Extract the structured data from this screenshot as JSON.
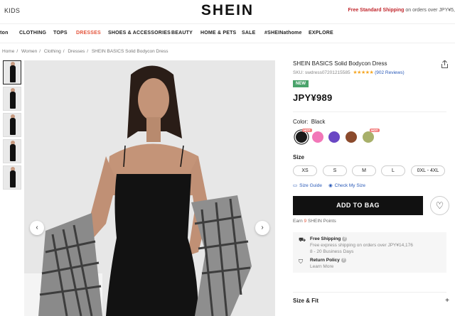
{
  "topbar": {
    "kids": "KIDS",
    "logo": "SHEIN",
    "promo_red": "Free Standard Shipping",
    "promo_rest": " on orders over JPY¥5,"
  },
  "nav": {
    "items": [
      {
        "label": "lton"
      },
      {
        "label": "CLOTHING"
      },
      {
        "label": "TOPS"
      },
      {
        "label": "DRESSES",
        "active": true
      },
      {
        "label": "SHOES & ACCESSORIES"
      },
      {
        "label": "BEAUTY"
      },
      {
        "label": "HOME & PETS"
      },
      {
        "label": "SALE"
      },
      {
        "label": "#SHEINathome"
      },
      {
        "label": "EXPLORE"
      }
    ]
  },
  "breadcrumb": [
    "Home",
    "Women",
    "Clothing",
    "Dresses",
    "SHEIN BASICS Solid Bodycon Dress"
  ],
  "gallery": {
    "thumbnail_count": 5,
    "prev_icon": "chevron-left-icon",
    "next_icon": "chevron-right-icon"
  },
  "product": {
    "title": "SHEIN BASICS Solid Bodycon Dress",
    "sku": "SKU: swdress07201215585",
    "stars": "★★★★★",
    "rating": 4.5,
    "reviews": "(902 Reviews)",
    "badge": "NEW",
    "price": "JPY¥989",
    "color_label": "Color:",
    "color_value": "Black",
    "swatches": [
      {
        "color": "#1a1a1a",
        "selected": true,
        "hot": true
      },
      {
        "color": "#f277b8"
      },
      {
        "color": "#6a47c4"
      },
      {
        "color": "#8b4a2c"
      },
      {
        "color": "#a8b06a",
        "hot": true
      }
    ],
    "hot_label": "HOT",
    "size_label": "Size",
    "sizes": [
      "XS",
      "S",
      "M",
      "L",
      "0XL - 4XL"
    ],
    "size_guide": "Size Guide",
    "check_size": "Check My Size",
    "add_to_bag": "ADD TO BAG",
    "points_prefix": "Earn ",
    "points_num": "9",
    "points_suffix": " SHEIN Points",
    "shipping_title": "Free Shipping",
    "shipping_desc": "Free express shipping on orders over JPY¥14,176",
    "shipping_days": "8 - 20 Business Days",
    "return_title": "Return Policy",
    "return_link": "Learn More",
    "size_fit": "Size & Fit",
    "size_fit_icon": "+"
  },
  "colors": {
    "accent": "#e4553c",
    "promo_red": "#c1272d",
    "badge_green": "#4aa36b",
    "link_blue": "#2a5ab8",
    "star": "#f5a623"
  }
}
